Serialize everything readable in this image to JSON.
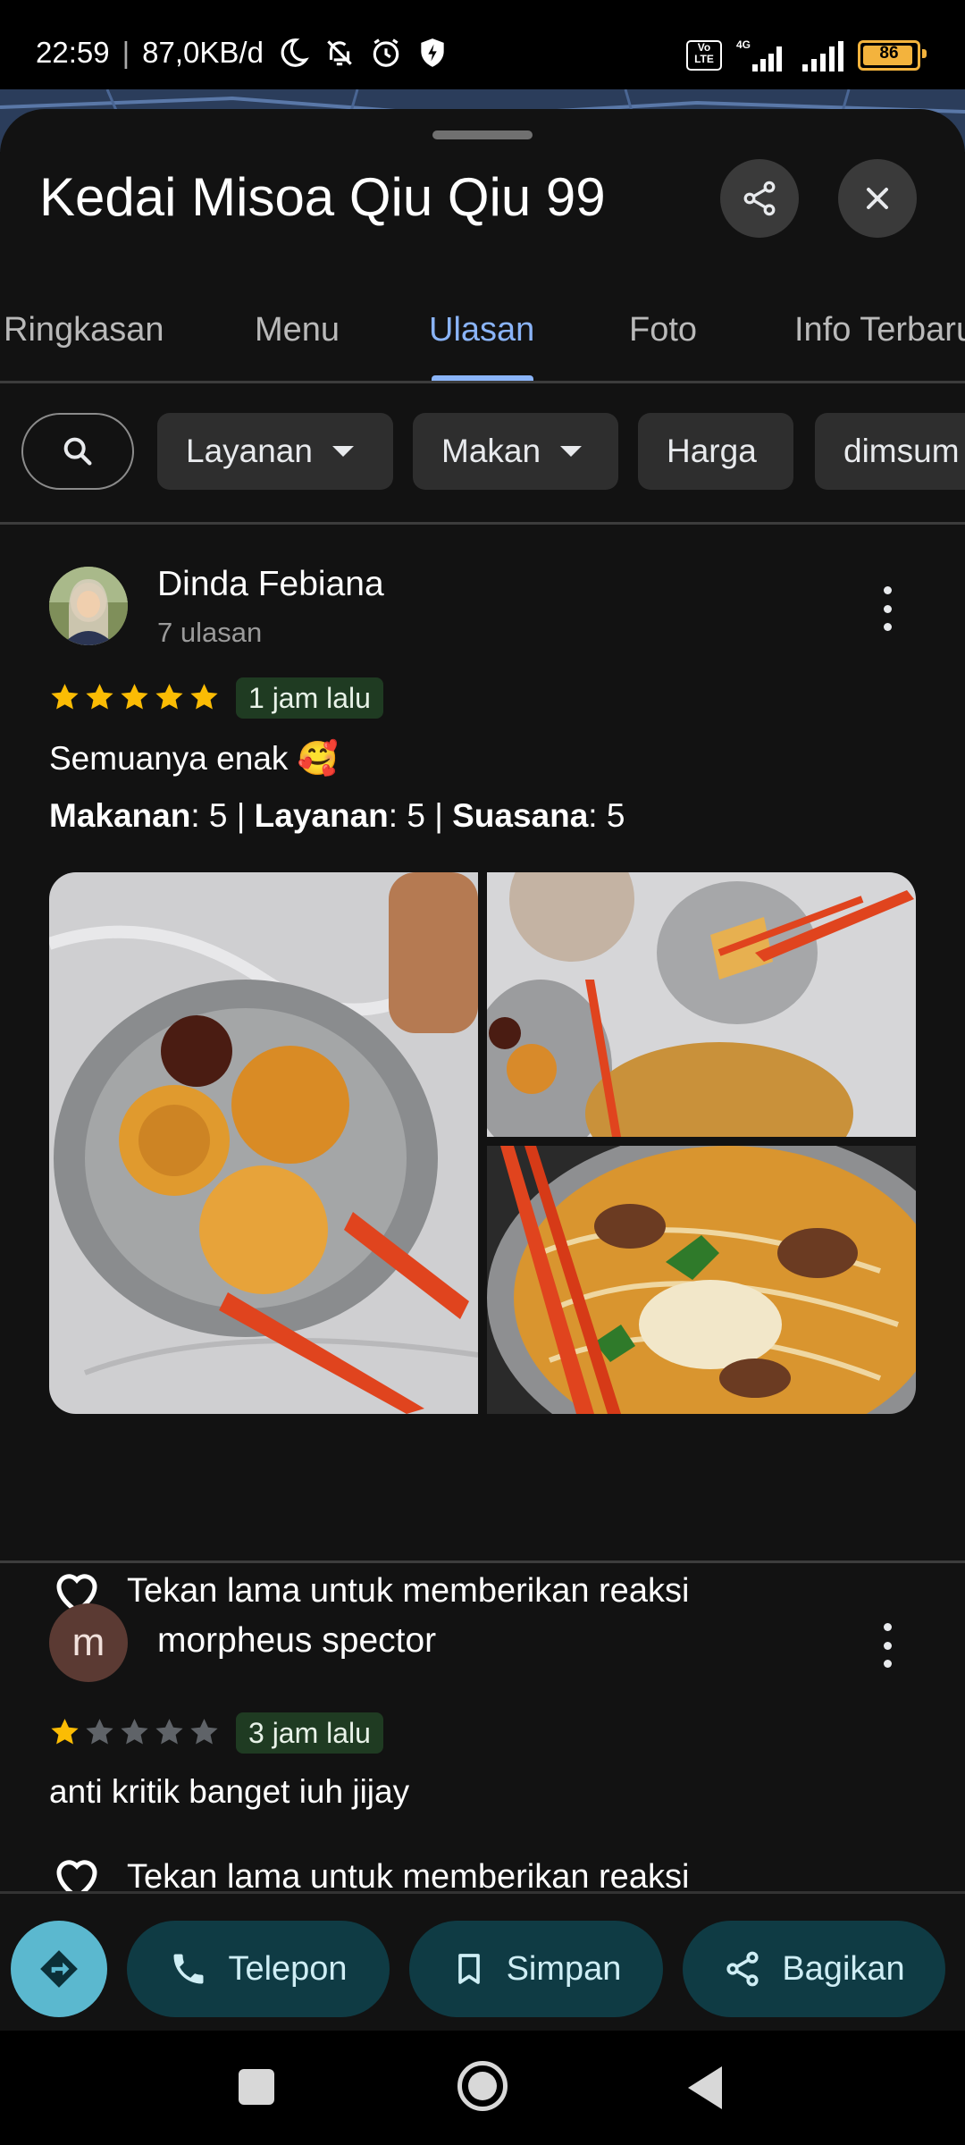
{
  "status_bar": {
    "time": "22:59",
    "network_speed": "87,0KB/d",
    "network_type": "4G",
    "volte": "Vo LTE",
    "battery": "86"
  },
  "place": {
    "name": "Kedai Misoa Qiu Qiu 99"
  },
  "tabs": [
    {
      "label": "Ringkasan"
    },
    {
      "label": "Menu"
    },
    {
      "label": "Ulasan",
      "active": true
    },
    {
      "label": "Foto"
    },
    {
      "label": "Info Terbaru"
    }
  ],
  "filters": [
    {
      "label": "Layanan",
      "dropdown": true
    },
    {
      "label": "Makan",
      "dropdown": true
    },
    {
      "label": "Harga",
      "dropdown": false
    },
    {
      "label": "dimsum",
      "dropdown": false
    }
  ],
  "reviews": [
    {
      "author": "Dinda Febiana",
      "review_count": "7 ulasan",
      "rating": 5,
      "time": "1 jam lalu",
      "text": "Semuanya enak 🥰",
      "sub_ratings": {
        "makanan_label": "Makanan",
        "makanan_value": ": 5 | ",
        "layanan_label": "Layanan",
        "layanan_value": ": 5 | ",
        "suasana_label": "Suasana",
        "suasana_value": ": 5"
      },
      "react_hint": "Tekan lama untuk memberikan reaksi"
    },
    {
      "author": "morpheus spector",
      "avatar_letter": "m",
      "rating": 1,
      "time": "3 jam lalu",
      "text": "anti kritik banget iuh jijay",
      "react_hint": "Tekan lama untuk memberikan reaksi"
    }
  ],
  "actions": {
    "call": "Telepon",
    "save": "Simpan",
    "share": "Bagikan"
  },
  "colors": {
    "accent": "#8ab4f8",
    "star": "#fbbc04",
    "action_pill": "#0f3b44",
    "directions": "#5bb8cf"
  }
}
